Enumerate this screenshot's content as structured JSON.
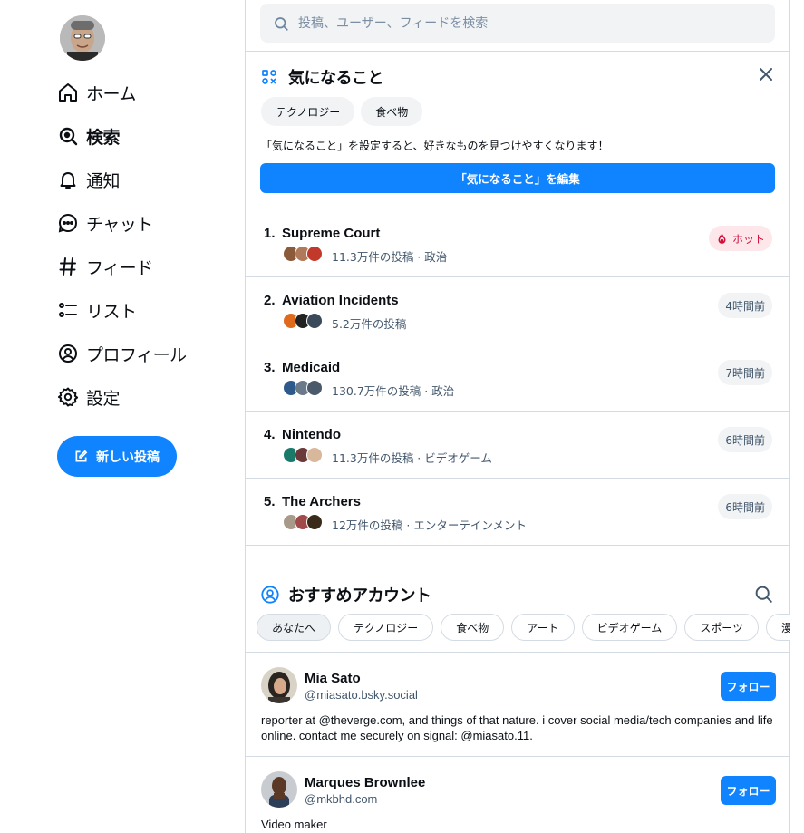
{
  "nav": {
    "avatar_alt": "",
    "items": [
      {
        "label": "ホーム",
        "icon": "home-icon"
      },
      {
        "label": "検索",
        "icon": "search-icon",
        "active": true
      },
      {
        "label": "通知",
        "icon": "bell-icon"
      },
      {
        "label": "チャット",
        "icon": "chat-icon"
      },
      {
        "label": "フィード",
        "icon": "hashtag-icon"
      },
      {
        "label": "リスト",
        "icon": "list-icon"
      },
      {
        "label": "プロフィール",
        "icon": "profile-icon"
      },
      {
        "label": "設定",
        "icon": "gear-icon"
      }
    ],
    "new_post_label": "新しい投稿"
  },
  "search": {
    "placeholder": "投稿、ユーザー、フィードを検索"
  },
  "interests": {
    "title": "気になること",
    "chips": [
      "テクノロジー",
      "食べ物"
    ],
    "hint": "「気になること」を設定すると、好きなものを見つけやすくなります！",
    "edit_label": "「気になること」を編集"
  },
  "trending": [
    {
      "rank": "1.",
      "name": "Supreme Court",
      "meta": "11.3万件の投稿 · 政治",
      "badge": "ホット",
      "hot": true
    },
    {
      "rank": "2.",
      "name": "Aviation Incidents",
      "meta": "5.2万件の投稿",
      "badge": "4時間前"
    },
    {
      "rank": "3.",
      "name": "Medicaid",
      "meta": "130.7万件の投稿 · 政治",
      "badge": "7時間前"
    },
    {
      "rank": "4.",
      "name": "Nintendo",
      "meta": "11.3万件の投稿 · ビデオゲーム",
      "badge": "6時間前"
    },
    {
      "rank": "5.",
      "name": "The Archers",
      "meta": "12万件の投稿 · エンターテインメント",
      "badge": "6時間前"
    }
  ],
  "suggested": {
    "title": "おすすめアカウント",
    "tabs": [
      "あなたへ",
      "テクノロジー",
      "食べ物",
      "アート",
      "ビデオゲーム",
      "スポーツ",
      "漫画"
    ],
    "accounts": [
      {
        "name": "Mia Sato",
        "handle": "@miasato.bsky.social",
        "bio": "reporter at @theverge.com, and things of that nature. i cover social media/tech companies and life online. contact me securely on signal: @miasato.11.",
        "follow_label": "フォロー"
      },
      {
        "name": "Marques Brownlee",
        "handle": "@mkbhd.com",
        "bio": "Video maker",
        "follow_label": "フォロー"
      }
    ]
  },
  "colors": {
    "accent": "#1083fe",
    "hot": "#d0103a",
    "muted": "#42576c",
    "border": "#d4dbe2"
  }
}
